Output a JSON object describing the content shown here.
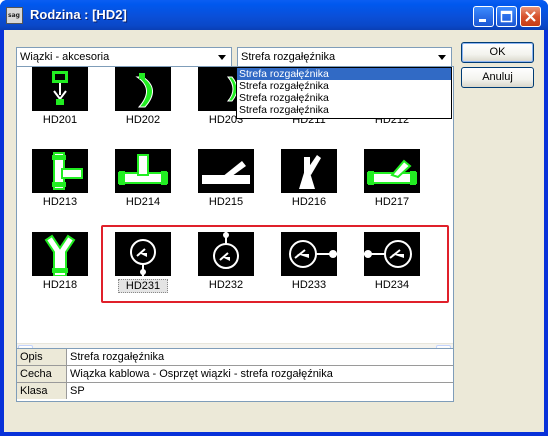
{
  "window": {
    "title": "Rodzina : [HD2]",
    "app_icon_text": "sag"
  },
  "combos": {
    "category": "Wiązki - akcesoria",
    "zone": "Strefa rozgałęźnika"
  },
  "dropdown_options": [
    "Strefa rozgałęźnika",
    "Strefa rozgałęźnika",
    "Strefa rozgałęźnika",
    "Strefa rozgałęźnika"
  ],
  "buttons": {
    "ok": "OK",
    "cancel": "Anuluj"
  },
  "gallery": [
    {
      "code": "HD201",
      "icon": "plug-down-icon"
    },
    {
      "code": "HD202",
      "icon": "arc-ribbon-icon"
    },
    {
      "code": "HD203",
      "icon": "arc-ribbon-small-icon"
    },
    {
      "code": "HD211",
      "icon": "blank-icon"
    },
    {
      "code": "HD212",
      "icon": "blank-icon"
    },
    {
      "code": "HD213",
      "icon": "tee-vertical-icon"
    },
    {
      "code": "HD214",
      "icon": "tee-horizontal-icon"
    },
    {
      "code": "HD215",
      "icon": "y-branch-icon"
    },
    {
      "code": "HD216",
      "icon": "y-branch-up-icon"
    },
    {
      "code": "HD217",
      "icon": "y-branch-angled-icon"
    },
    {
      "code": "HD218",
      "icon": "y-pipe-icon"
    },
    {
      "code": "HD231",
      "icon": "circle-lead-bottom-icon"
    },
    {
      "code": "HD232",
      "icon": "circle-lead-top-icon"
    },
    {
      "code": "HD233",
      "icon": "circle-lead-right-icon"
    },
    {
      "code": "HD234",
      "icon": "circle-lead-left-icon"
    }
  ],
  "properties": [
    {
      "key": "Opis",
      "value": "Strefa rozgałęźnika"
    },
    {
      "key": "Cecha",
      "value": "Wiązka kablowa - Osprzęt wiązki - strefa rozgałęźnika"
    },
    {
      "key": "Klasa",
      "value": "SP"
    }
  ],
  "colors": {
    "highlight_border": "#e0202a",
    "symbol_green": "#22ee22",
    "title_bar": "#0a5ef3"
  }
}
